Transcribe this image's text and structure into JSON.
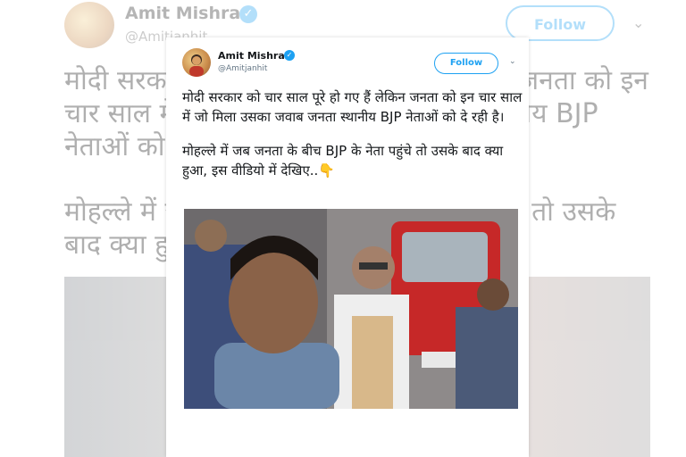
{
  "tweet": {
    "display_name": "Amit Mishra",
    "handle": "@Amitjanhit",
    "follow_label": "Follow",
    "verified_glyph": "✓",
    "chevron_glyph": "⌄",
    "paragraph_1": "मोदी सरकार को चार साल पूरे हो गए हैं लेकिन जनता को इन चार साल में जो मिला उसका जवाब जनता स्थानीय BJP नेताओं को दे रही है।",
    "paragraph_2": "मोहल्ले में जब जनता के बीच BJP के नेता पहुंचे तो उसके बाद क्या हुआ, इस वीडियो में देखिए..",
    "emoji": "👇"
  },
  "colors": {
    "accent": "#1da1f2",
    "text": "#14171a",
    "secondary": "#657786"
  },
  "icons": [
    "verified-badge-icon",
    "chevron-down-icon",
    "pointing-down-emoji"
  ]
}
